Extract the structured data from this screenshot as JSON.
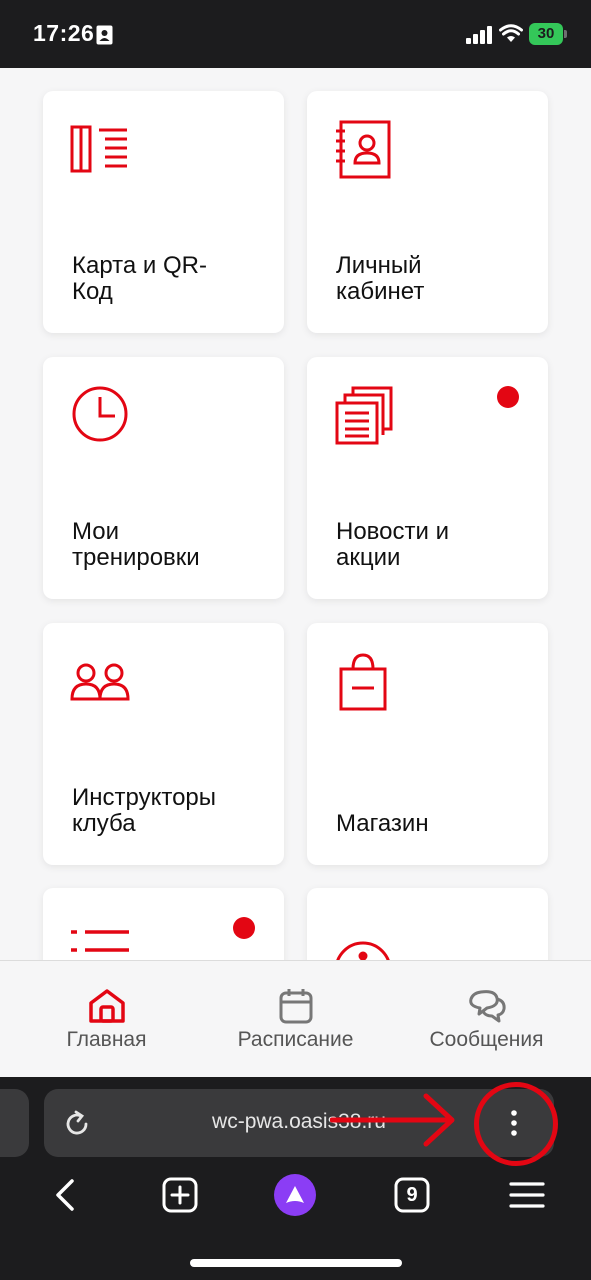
{
  "status": {
    "time": "17:26",
    "battery": "30",
    "battery_color": "#34c759"
  },
  "theme": {
    "accent": "#e30613",
    "tile_background": "#ffffff",
    "page_background": "#f6f6f7"
  },
  "tiles": [
    {
      "label": "Карта и QR-\nКод",
      "icon": "card-list-icon",
      "badge": false
    },
    {
      "label": "Личный\nкабинет",
      "icon": "contact-book-icon",
      "badge": false
    },
    {
      "label": "Мои\nтренировки",
      "icon": "clock-icon",
      "badge": false
    },
    {
      "label": "Новости и\nакции",
      "icon": "documents-icon",
      "badge": true
    },
    {
      "label": "Инструкторы\nклуба",
      "icon": "people-icon",
      "badge": false
    },
    {
      "label": "Магазин",
      "icon": "shopping-bag-icon",
      "badge": false
    },
    {
      "label": "",
      "icon": "list-icon",
      "badge": true
    },
    {
      "label": "",
      "icon": "info-icon",
      "badge": false
    }
  ],
  "bottom_nav": {
    "home": "Главная",
    "schedule": "Расписание",
    "messages": "Сообщения"
  },
  "browser": {
    "url": "wc-pwa.oasis38.ru",
    "tab_count": "9"
  }
}
